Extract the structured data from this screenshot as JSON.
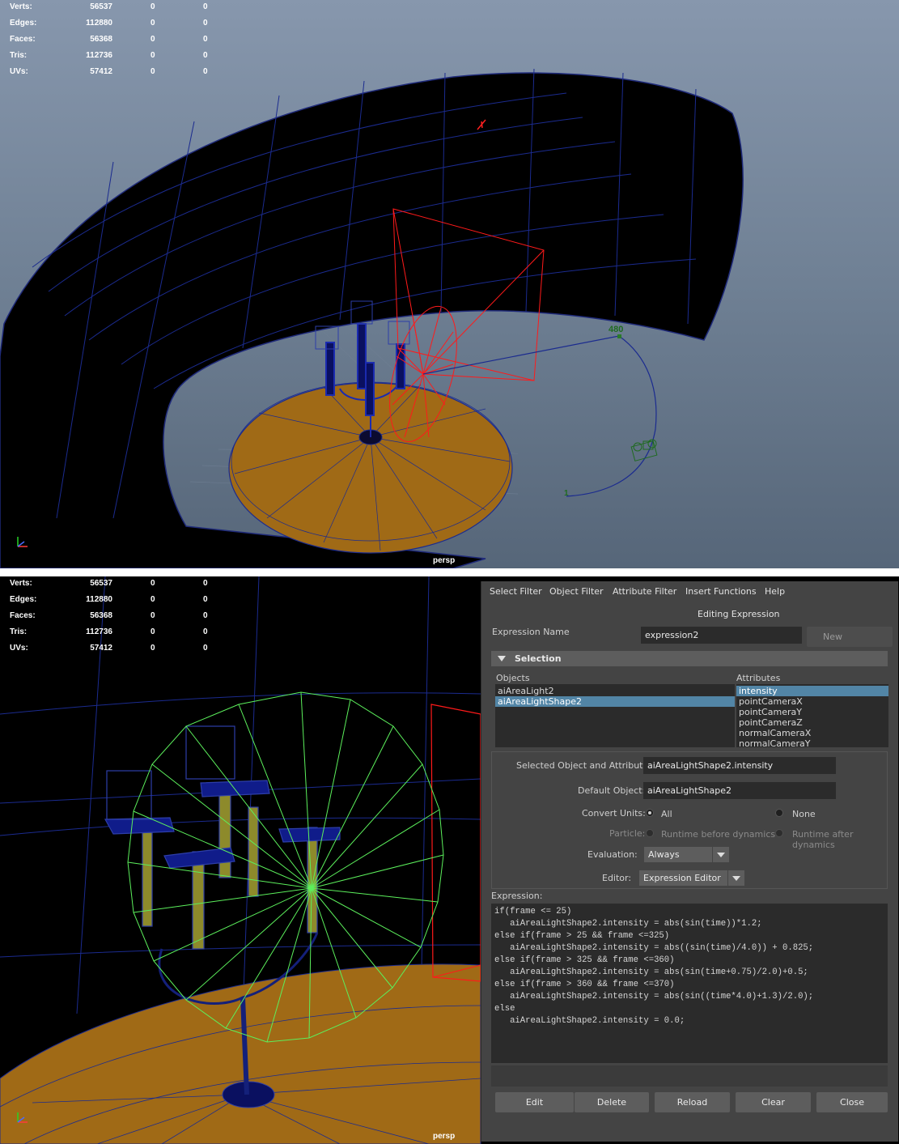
{
  "hud": {
    "rows": [
      {
        "label": "Verts:",
        "v1": "56537",
        "v2": "0",
        "v3": "0"
      },
      {
        "label": "Edges:",
        "v1": "112880",
        "v2": "0",
        "v3": "0"
      },
      {
        "label": "Faces:",
        "v1": "56368",
        "v2": "0",
        "v3": "0"
      },
      {
        "label": "Tris:",
        "v1": "112736",
        "v2": "0",
        "v3": "0"
      },
      {
        "label": "UVs:",
        "v1": "57412",
        "v2": "0",
        "v3": "0"
      }
    ]
  },
  "viewport_top": {
    "camera_label": "persp",
    "frame_marker": "480",
    "path_start_marker": "1"
  },
  "viewport_bottom": {
    "camera_label": "persp"
  },
  "axis_gizmo": {
    "x": "x",
    "y": "y",
    "z": "z"
  },
  "expression_editor": {
    "menu": [
      "Select Filter",
      "Object Filter",
      "Attribute Filter",
      "Insert Functions",
      "Help"
    ],
    "title": "Editing Expression",
    "expression_name_label": "Expression Name",
    "expression_name_value": "expression2",
    "new_expression_button": "New Expression",
    "selection_section": "Selection",
    "objects_label": "Objects",
    "objects": [
      "aiAreaLight2",
      "aiAreaLightShape2"
    ],
    "objects_selected": "aiAreaLightShape2",
    "attributes_label": "Attributes",
    "attributes": [
      "intensity",
      "pointCameraX",
      "pointCameraY",
      "pointCameraZ",
      "normalCameraX",
      "normalCameraY"
    ],
    "attributes_selected": "intensity",
    "selected_obj_attr_label": "Selected Object and Attribute:",
    "selected_obj_attr_value": "aiAreaLightShape2.intensity",
    "default_object_label": "Default Object:",
    "default_object_value": "aiAreaLightShape2",
    "convert_units_label": "Convert Units:",
    "convert_all": "All",
    "convert_none": "None",
    "convert_selected": "All",
    "particle_label": "Particle:",
    "particle_before": "Runtime before dynamics",
    "particle_after": "Runtime after dynamics",
    "evaluation_label": "Evaluation:",
    "evaluation_value": "Always",
    "editor_label": "Editor:",
    "editor_value": "Expression Editor",
    "expression_label": "Expression:",
    "expression_text": "if(frame <= 25)\n   aiAreaLightShape2.intensity = abs(sin(time))*1.2;\nelse if(frame > 25 && frame <=325)\n   aiAreaLightShape2.intensity = abs((sin(time)/4.0)) + 0.825;\nelse if(frame > 325 && frame <=360)\n   aiAreaLightShape2.intensity = abs(sin(time+0.75)/2.0)+0.5;\nelse if(frame > 360 && frame <=370)\n   aiAreaLightShape2.intensity = abs(sin((time*4.0)+1.3)/2.0);\nelse\n   aiAreaLightShape2.intensity = 0.0;",
    "buttons": {
      "edit": "Edit",
      "delete": "Delete",
      "reload": "Reload",
      "clear": "Clear",
      "close": "Close"
    }
  }
}
